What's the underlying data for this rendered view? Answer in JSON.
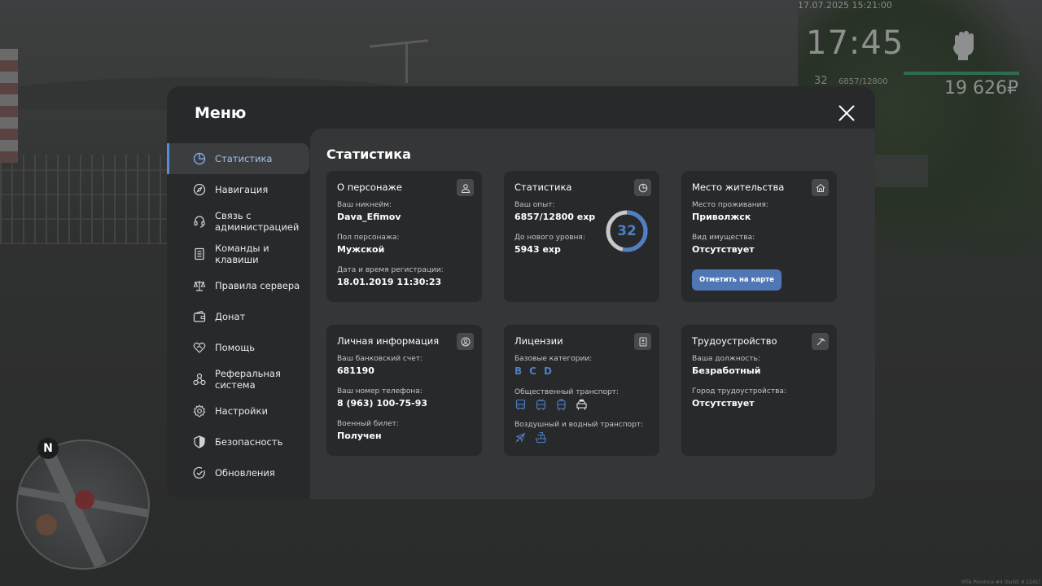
{
  "hud": {
    "datetime": "17.07.2025 15:21:00",
    "clock": "17:45",
    "level": "32",
    "exp": "6857/12800",
    "money": "19 626₽",
    "build": "MTA Province #4 (build: 6.1241)"
  },
  "minimap": {
    "north": "N"
  },
  "menu": {
    "title": "Меню",
    "sidebar": [
      {
        "label": "Статистика",
        "icon": "pie-chart-icon",
        "active": true
      },
      {
        "label": "Навигация",
        "icon": "compass-icon"
      },
      {
        "label": "Связь с администрацией",
        "icon": "headset-icon"
      },
      {
        "label": "Команды и клавиши",
        "icon": "document-list-icon"
      },
      {
        "label": "Правила сервера",
        "icon": "scales-icon"
      },
      {
        "label": "Донат",
        "icon": "wallet-icon"
      },
      {
        "label": "Помощь",
        "icon": "handshake-heart-icon"
      },
      {
        "label": "Реферальная система",
        "icon": "referral-nodes-icon"
      },
      {
        "label": "Настройки",
        "icon": "gear-icon"
      },
      {
        "label": "Безопасность",
        "icon": "shield-icon"
      },
      {
        "label": "Обновления",
        "icon": "check-circle-icon"
      }
    ]
  },
  "stats": {
    "title": "Статистика",
    "character": {
      "title": "О персонаже",
      "nickname_label": "Ваш никнейм:",
      "nickname": "Dava_Efimov",
      "gender_label": "Пол персонажа:",
      "gender": "Мужской",
      "reg_label": "Дата и время регистрации:",
      "reg_date": "18.01.2019 11:30:23"
    },
    "statistics": {
      "title": "Статистика",
      "exp_label": "Ваш опыт:",
      "exp": "6857/12800 exp",
      "next_label": "До нового уровня:",
      "next": "5943 exp",
      "level": "32",
      "progress": 0.5357,
      "ring_color": "#4f7fc4"
    },
    "residence": {
      "title": "Место жительства",
      "place_label": "Место проживания:",
      "place": "Приволжск",
      "property_label": "Вид имущества:",
      "property": "Отсутствует",
      "map_button": "Отметить на карте"
    },
    "personal": {
      "title": "Личная информация",
      "bank_label": "Ваш банковский счет:",
      "bank": "681190",
      "phone_label": "Ваш номер телефона:",
      "phone": "8 (963) 100-75-93",
      "military_label": "Военный билет:",
      "military": "Получен"
    },
    "licenses": {
      "title": "Лицензии",
      "basic_label": "Базовые категории:",
      "categories": [
        "B",
        "C",
        "D"
      ],
      "public_label": "Общественный транспорт:",
      "air_label": "Воздушный и водный транспорт:"
    },
    "employment": {
      "title": "Трудоустройство",
      "position_label": "Ваша должность:",
      "position": "Безработный",
      "city_label": "Город трудоустройства:",
      "city": "Отсутствует"
    }
  },
  "colors": {
    "accent": "#4f7fc4",
    "active_bar": "#5b8ed8",
    "button": "#4f76b5"
  }
}
